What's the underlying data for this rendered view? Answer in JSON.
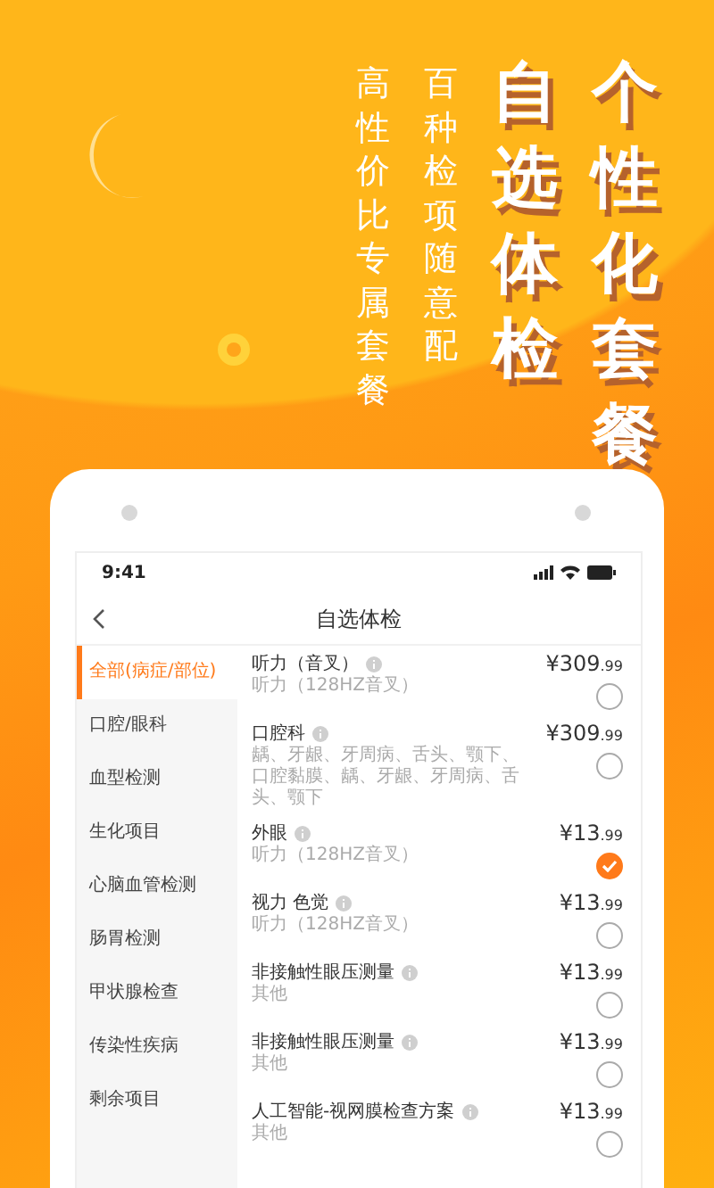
{
  "promo": {
    "tagline_columns": [
      "高性价比专属套餐",
      "百种检项随意配"
    ],
    "headline_columns": [
      "自选体检",
      "个性化套餐"
    ]
  },
  "phone": {
    "status_bar": {
      "time": "9:41"
    },
    "nav": {
      "title": "自选体检"
    },
    "categories": [
      {
        "label": "全部(病症/部位)",
        "selected": true
      },
      {
        "label": "口腔/眼科",
        "selected": false
      },
      {
        "label": "血型检测",
        "selected": false
      },
      {
        "label": "生化项目",
        "selected": false
      },
      {
        "label": "心脑血管检测",
        "selected": false
      },
      {
        "label": "肠胃检测",
        "selected": false
      },
      {
        "label": "甲状腺检查",
        "selected": false
      },
      {
        "label": "传染性疾病",
        "selected": false
      },
      {
        "label": "剩余项目",
        "selected": false
      }
    ],
    "items": [
      {
        "name": "听力（音叉）",
        "price": "¥309",
        "price_decimal": ".99",
        "description": "听力（128HZ音叉）",
        "checked": false
      },
      {
        "name": "口腔科",
        "price": "¥309",
        "price_decimal": ".99",
        "description": "龋、牙龈、牙周病、舌头、颚下、口腔黏膜、龋、牙龈、牙周病、舌头、颚下",
        "checked": false
      },
      {
        "name": "外眼",
        "price": "¥13",
        "price_decimal": ".99",
        "description": "听力（128HZ音叉）",
        "checked": true
      },
      {
        "name": "视力 色觉",
        "price": "¥13",
        "price_decimal": ".99",
        "description": "听力（128HZ音叉）",
        "checked": false
      },
      {
        "name": "非接触性眼压测量",
        "price": "¥13",
        "price_decimal": ".99",
        "description": "其他",
        "checked": false
      },
      {
        "name": "非接触性眼压测量",
        "price": "¥13",
        "price_decimal": ".99",
        "description": "其他",
        "checked": false
      },
      {
        "name": "人工智能-视网膜检查方案",
        "price": "¥13",
        "price_decimal": ".99",
        "description": "其他",
        "checked": false
      }
    ]
  }
}
